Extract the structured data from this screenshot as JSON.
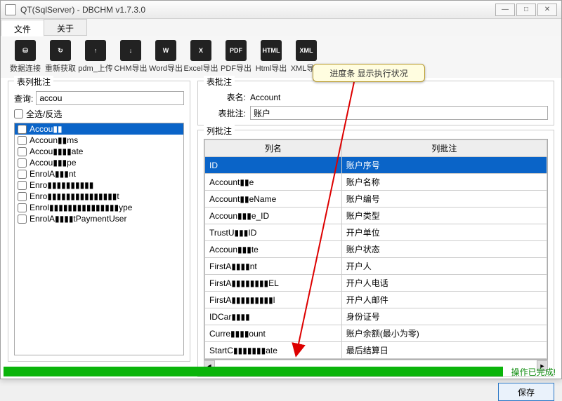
{
  "window": {
    "title_prefix": "QT",
    "title_suffix": "(SqlServer) - DBCHM v1.7.3.0",
    "btn_min": "—",
    "btn_max": "□",
    "btn_close": "✕"
  },
  "menu": {
    "file": "文件",
    "about": "关于"
  },
  "toolbar": [
    {
      "icon": "⛁",
      "label": "数据连接"
    },
    {
      "icon": "↻",
      "label": "重新获取"
    },
    {
      "icon": "↑",
      "label": "pdm_上传"
    },
    {
      "icon": "↓",
      "label": "CHM导出"
    },
    {
      "icon": "W",
      "label": "Word导出"
    },
    {
      "icon": "X",
      "label": "Excel导出"
    },
    {
      "icon": "PDF",
      "label": "PDF导出"
    },
    {
      "icon": "HTML",
      "label": "Html导出"
    },
    {
      "icon": "XML",
      "label": "XML导出"
    }
  ],
  "left": {
    "group_title": "表列批注",
    "query_label": "查询:",
    "query_value": "accou",
    "selall_label": "全选/反选",
    "items": [
      "Accou▮▮",
      "Accoun▮▮ms",
      "Accou▮▮▮▮ate",
      "Accou▮▮▮pe",
      "EnrolA▮▮▮nt",
      "Enro▮▮▮▮▮▮▮▮▮▮",
      "Enro▮▮▮▮▮▮▮▮▮▮▮▮▮▮▮t",
      "Enrol▮▮▮▮▮▮▮▮▮▮▮▮▮▮▮ype",
      "EnrolA▮▮▮▮tPaymentUser"
    ]
  },
  "right": {
    "top_group_title": "表批注",
    "table_label": "表名:",
    "table_value": "Account",
    "remark_label": "表批注:",
    "remark_value": "账户",
    "mid_group_title": "列批注",
    "col_name": "列名",
    "col_remark": "列批注",
    "rows": [
      {
        "c": "ID",
        "r": "账户序号"
      },
      {
        "c": "Account▮▮e",
        "r": "账户名称"
      },
      {
        "c": "Account▮▮eName",
        "r": "账户编号"
      },
      {
        "c": "Accoun▮▮▮e_ID",
        "r": "账户类型"
      },
      {
        "c": "TrustU▮▮▮ID",
        "r": "开户单位"
      },
      {
        "c": "Accoun▮▮▮te",
        "r": "账户状态"
      },
      {
        "c": "FirstA▮▮▮▮nt",
        "r": "开户人"
      },
      {
        "c": "FirstA▮▮▮▮▮▮▮▮EL",
        "r": "开户人电话"
      },
      {
        "c": "FirstA▮▮▮▮▮▮▮▮▮l",
        "r": "开户人邮件"
      },
      {
        "c": "IDCar▮▮▮▮",
        "r": "身份证号"
      },
      {
        "c": "Curre▮▮▮▮ount",
        "r": "账户余额(最小为零)"
      },
      {
        "c": "StartC▮▮▮▮▮▮▮ate",
        "r": "最后结算日"
      }
    ],
    "save": "保存"
  },
  "callout": "进度条 显示执行状况",
  "status": "操作已完成!"
}
